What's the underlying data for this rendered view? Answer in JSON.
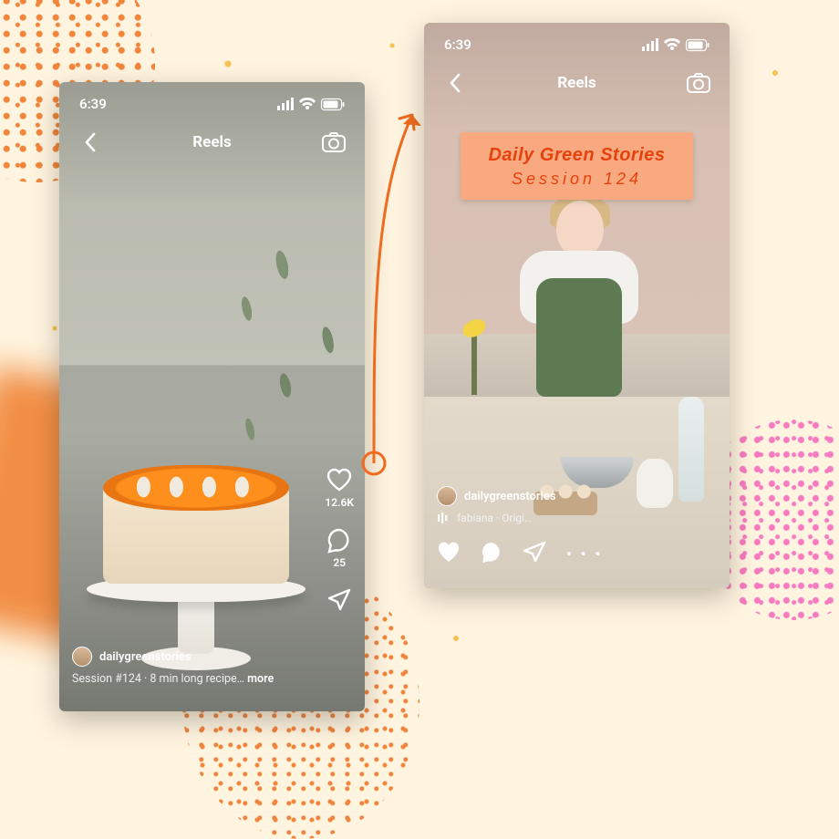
{
  "phoneA": {
    "status_time": "6:39",
    "nav_title": "Reels",
    "right_rail": {
      "likes_count": "12.6K",
      "comments_count": "25"
    },
    "username": "dailygreenstories",
    "caption_text": "Session #124 ·  8 min long recipe… ",
    "caption_more": "more"
  },
  "phoneB": {
    "status_time": "6:39",
    "nav_title": "Reels",
    "banner": {
      "line1": "Daily Green Stories",
      "line2": "Session 124"
    },
    "username": "dailygreenstories",
    "audio_label": "fabiana · Origi…",
    "more_dots": "• • •"
  },
  "colors": {
    "arrow": "#ef6c1f",
    "banner_bg": "#f9a97f",
    "banner_text": "#e6420e"
  }
}
